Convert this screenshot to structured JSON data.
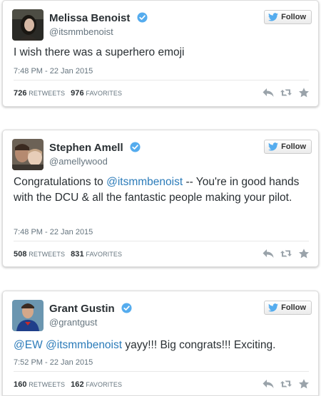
{
  "colors": {
    "link": "#2b7bb9",
    "verified": "#55acee",
    "muted": "#66757f",
    "follow_bird": "#55acee"
  },
  "tweets": [
    {
      "name": "Melissa Benoist",
      "handle": "@itsmmbenoist",
      "follow_label": "Follow",
      "text_parts": [
        {
          "type": "text",
          "value": "I wish there was a superhero emoji"
        }
      ],
      "timestamp": "7:48 PM - 22 Jan 2015",
      "retweets": "726",
      "retweets_label": "RETWEETS",
      "favorites": "976",
      "favorites_label": "FAVORITES"
    },
    {
      "name": "Stephen Amell",
      "handle": "@amellywood",
      "follow_label": "Follow",
      "text_parts": [
        {
          "type": "text",
          "value": "Congratulations to "
        },
        {
          "type": "mention",
          "value": "@itsmmbenoist"
        },
        {
          "type": "text",
          "value": " -- You're in good hands with the DCU & all the fantastic people making your pilot."
        }
      ],
      "timestamp": "7:48 PM - 22 Jan 2015",
      "retweets": "508",
      "retweets_label": "RETWEETS",
      "favorites": "831",
      "favorites_label": "FAVORITES"
    },
    {
      "name": "Grant Gustin",
      "handle": "@grantgust",
      "follow_label": "Follow",
      "text_parts": [
        {
          "type": "mention",
          "value": "@EW"
        },
        {
          "type": "text",
          "value": " "
        },
        {
          "type": "mention",
          "value": "@itsmmbenoist"
        },
        {
          "type": "text",
          "value": " yayy!!! Big congrats!!! Exciting."
        }
      ],
      "timestamp": "7:52 PM - 22 Jan 2015",
      "retweets": "160",
      "retweets_label": "RETWEETS",
      "favorites": "162",
      "favorites_label": "FAVORITES"
    }
  ]
}
